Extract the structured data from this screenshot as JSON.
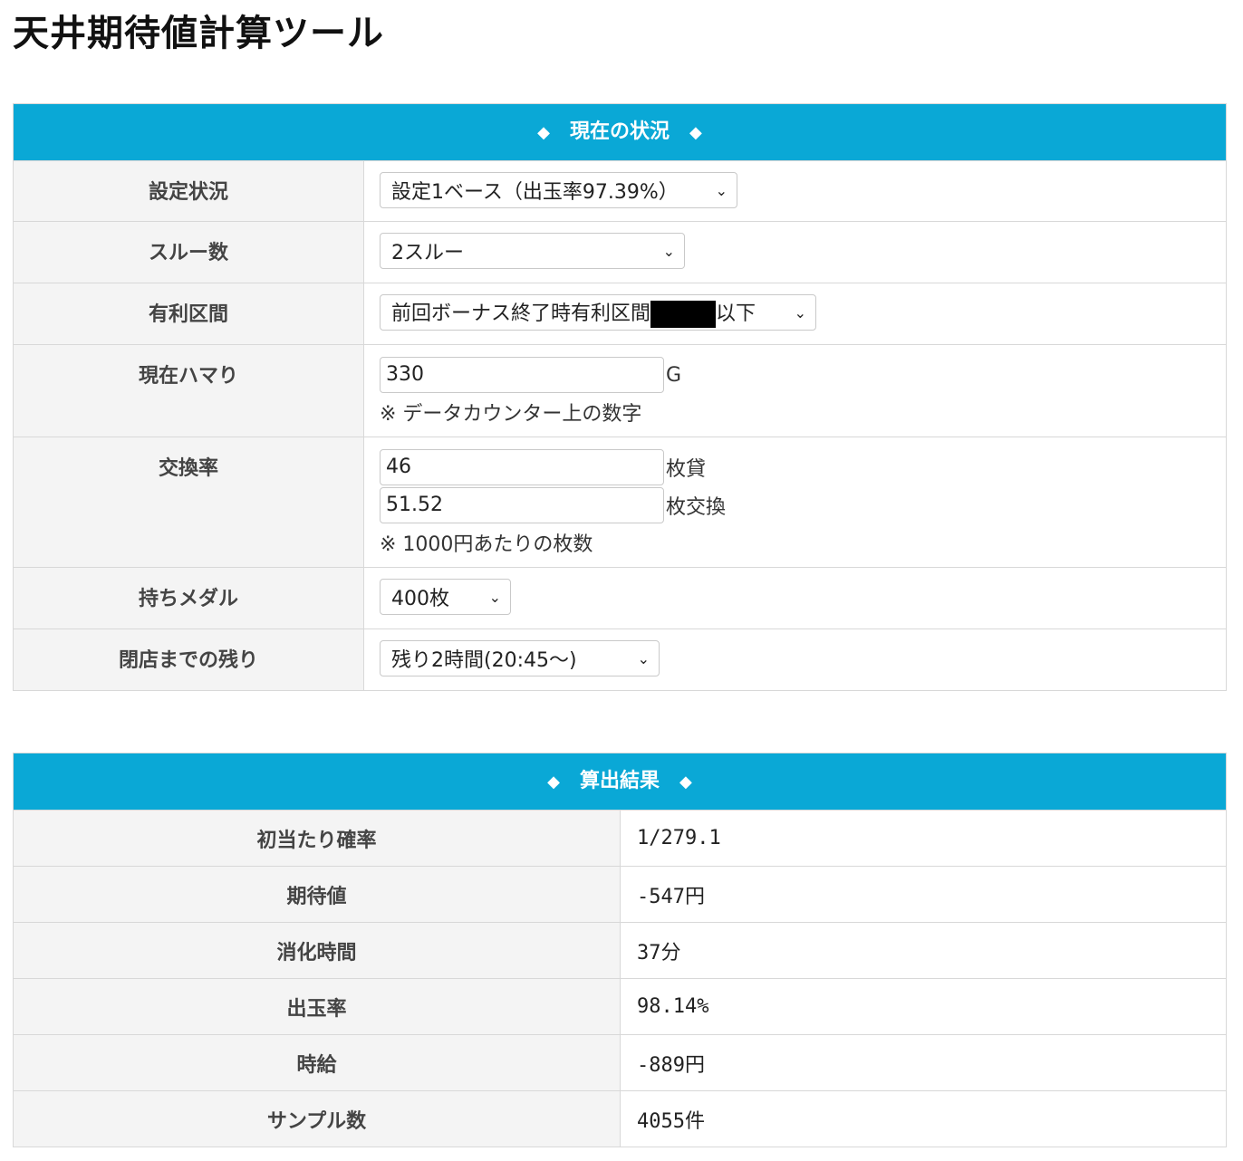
{
  "title": "天井期待値計算ツール",
  "status_panel": {
    "header": "現在の状況",
    "diamond": "◆",
    "settei": {
      "label": "設定状況",
      "value": "設定1ベース（出玉率97.39%）"
    },
    "through": {
      "label": "スルー数",
      "value": "2スルー"
    },
    "yuuri": {
      "label": "有利区間",
      "value_prefix": "前回ボーナス終了時有利区間",
      "value_suffix": "以下"
    },
    "hamari": {
      "label": "現在ハマり",
      "value": "330",
      "unit": "G",
      "note": "※ データカウンター上の数字"
    },
    "koukan": {
      "label": "交換率",
      "value1": "46",
      "unit1": "枚貸",
      "value2": "51.52",
      "unit2": "枚交換",
      "note": "※ 1000円あたりの枚数"
    },
    "medal": {
      "label": "持ちメダル",
      "value": "400枚"
    },
    "heiten": {
      "label": "閉店までの残り",
      "value": "残り2時間(20:45〜)"
    }
  },
  "result_panel": {
    "header": "算出結果",
    "diamond": "◆",
    "rows": [
      {
        "label": "初当たり確率",
        "value": "1/279.1"
      },
      {
        "label": "期待値",
        "value": "-547円"
      },
      {
        "label": "消化時間",
        "value": "37分"
      },
      {
        "label": "出玉率",
        "value": "98.14%"
      },
      {
        "label": "時給",
        "value": "-889円"
      },
      {
        "label": "サンプル数",
        "value": "4055件"
      }
    ]
  },
  "colors": {
    "accent": "#0aa8d6",
    "label_bg": "#f4f4f4",
    "border": "#d8d8d8"
  },
  "icons": {
    "select_arrow": "chevron-down-icon",
    "header_ornament": "diamond-icon"
  }
}
